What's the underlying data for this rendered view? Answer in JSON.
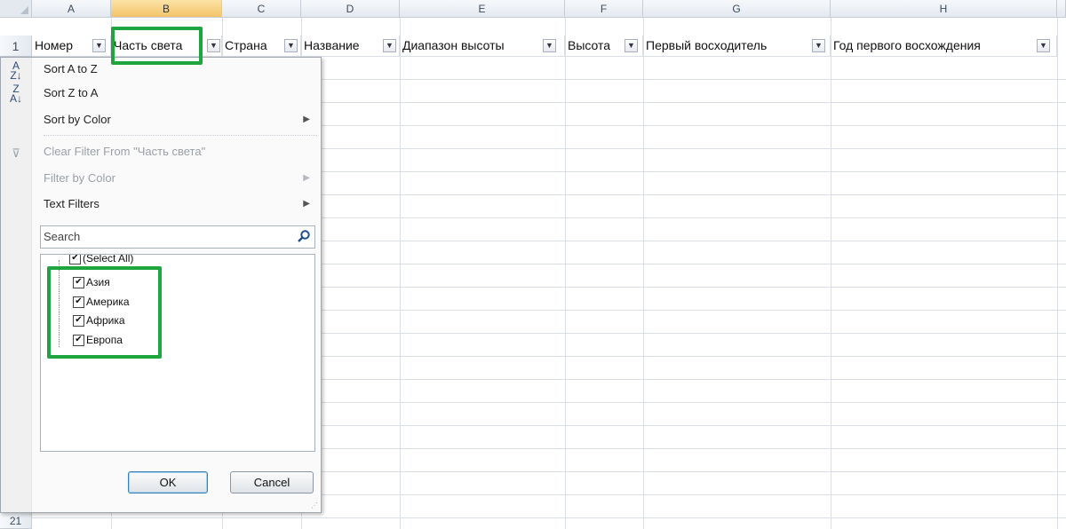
{
  "columns": [
    "A",
    "B",
    "C",
    "D",
    "E",
    "F",
    "G",
    "H"
  ],
  "row_numbers": {
    "header_row": "1",
    "last_row": "21"
  },
  "headers": [
    "Номер",
    "Часть света",
    "Страна",
    "Название",
    "Диапазон высоты",
    "Высота",
    "Первый восходитель",
    "Год первого восхождения"
  ],
  "menu": {
    "sort_az": "Sort A to Z",
    "sort_za": "Sort Z to A",
    "sort_by_color": "Sort by Color",
    "clear_filter": "Clear Filter From \"Часть света\"",
    "filter_by_color": "Filter by Color",
    "text_filters": "Text Filters",
    "search_placeholder": "Search",
    "select_all": "(Select All)",
    "items": [
      "Азия",
      "Америка",
      "Африка",
      "Европа"
    ],
    "ok": "OK",
    "cancel": "Cancel"
  },
  "colors": {
    "highlight": "#1ea53f",
    "selected_column": "#f4c46a"
  }
}
